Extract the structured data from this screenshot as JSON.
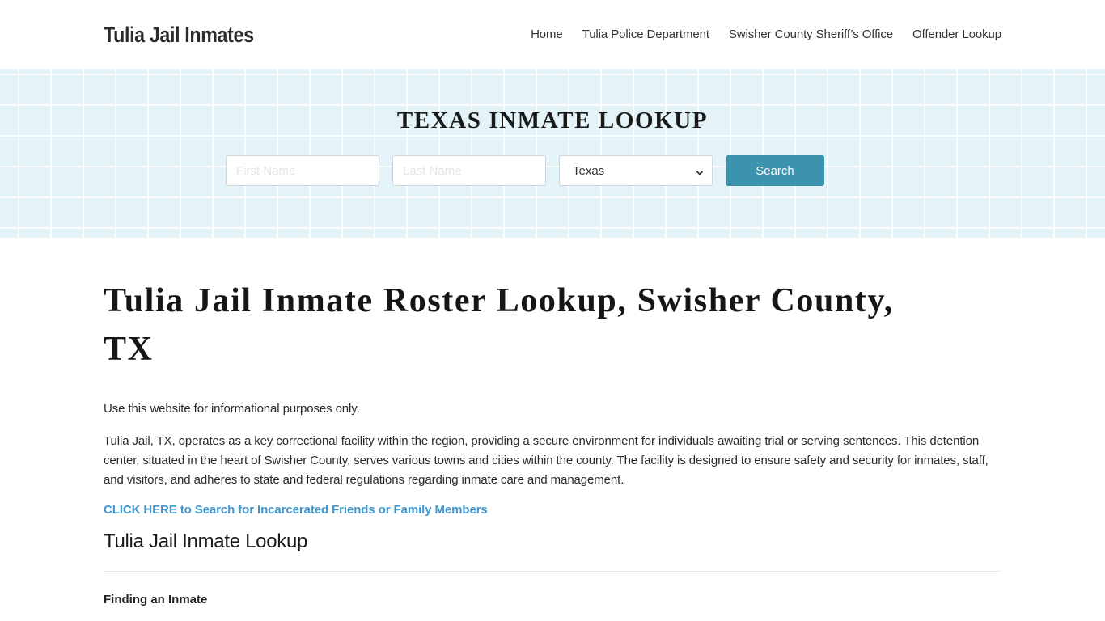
{
  "header": {
    "brand": "Tulia Jail Inmates",
    "nav": [
      {
        "label": "Home"
      },
      {
        "label": "Tulia Police Department"
      },
      {
        "label": "Swisher County Sheriff’s Office"
      },
      {
        "label": "Offender Lookup"
      }
    ]
  },
  "hero": {
    "title": "TEXAS INMATE LOOKUP",
    "first_name_placeholder": "First Name",
    "last_name_placeholder": "Last Name",
    "state_selected": "Texas",
    "search_label": "Search",
    "colors": {
      "background": "#e3f3f7",
      "button": "#3c93ad"
    }
  },
  "main": {
    "title": "Tulia Jail Inmate Roster Lookup, Swisher County, TX",
    "disclaimer": "Use this website for informational purposes only.",
    "intro": "Tulia Jail, TX, operates as a key correctional facility within the region, providing a secure environment for individuals awaiting trial or serving sentences. This detention center, situated in the heart of Swisher County, serves various towns and cities within the county. The facility is designed to ensure safety and security for inmates, staff, and visitors, and adheres to state and federal regulations regarding inmate care and management.",
    "cta_link": "CLICK HERE to Search for Incarcerated Friends or Family Members",
    "cta_color": "#4098d0",
    "section_title": "Tulia Jail Inmate Lookup",
    "subsection_title": "Finding an Inmate"
  }
}
